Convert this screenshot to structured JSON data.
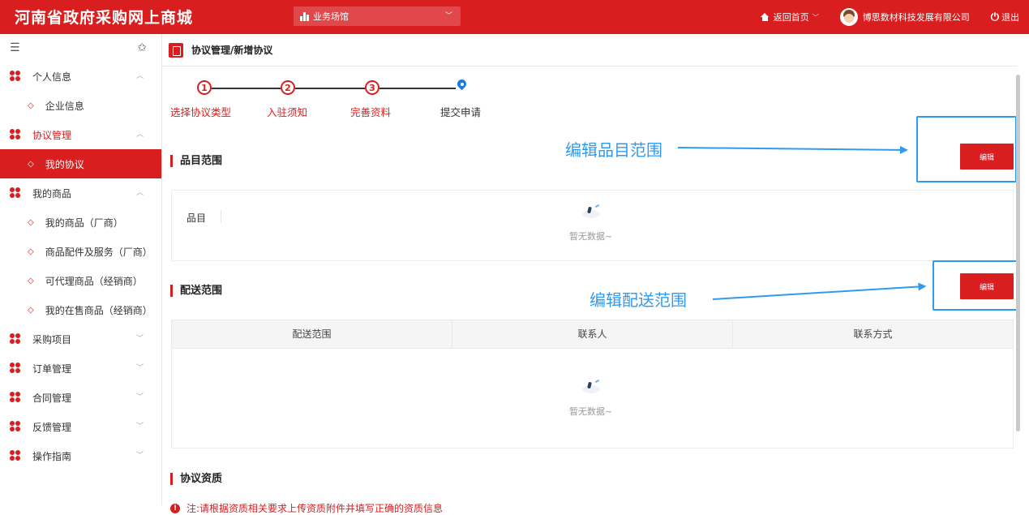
{
  "header": {
    "brand": "河南省政府采购网上商城",
    "venue_label": "业务场馆",
    "home_label": "返回首页",
    "company": "博思数材科技发展有限公司",
    "logout": "退出"
  },
  "sidebar": {
    "groups": [
      {
        "label": "个人信息",
        "arrow": "︿",
        "items": [
          {
            "label": "企业信息"
          }
        ]
      },
      {
        "label": "协议管理",
        "arrow": "︿",
        "items": [
          {
            "label": "我的协议"
          }
        ]
      },
      {
        "label": "我的商品",
        "arrow": "︿",
        "items": [
          {
            "label": "我的商品（厂商）"
          },
          {
            "label": "商品配件及服务（厂商）"
          },
          {
            "label": "可代理商品（经销商）"
          },
          {
            "label": "我的在售商品（经销商）"
          }
        ]
      },
      {
        "label": "采购项目",
        "arrow": "﹀"
      },
      {
        "label": "订单管理",
        "arrow": "﹀"
      },
      {
        "label": "合同管理",
        "arrow": "﹀"
      },
      {
        "label": "反馈管理",
        "arrow": "﹀"
      },
      {
        "label": "操作指南",
        "arrow": "﹀"
      }
    ]
  },
  "main": {
    "breadcrumb": "协议管理/新增协议",
    "steps": [
      {
        "num": "1",
        "label": "选择协议类型"
      },
      {
        "num": "2",
        "label": "入驻须知"
      },
      {
        "num": "3",
        "label": "完善资料"
      },
      {
        "num": "",
        "label": "提交申请"
      }
    ],
    "category_section": {
      "title": "品目范围",
      "edit_label": "编辑",
      "annotation": "编辑品目范围",
      "field_label": "品目",
      "empty_text": "暂无数据~"
    },
    "delivery_section": {
      "title": "配送范围",
      "edit_label": "编辑",
      "annotation": "编辑配送范围",
      "columns": [
        "配送范围",
        "联系人",
        "联系方式"
      ],
      "empty_text": "暂无数据~"
    },
    "qualification_section": {
      "title": "协议资质",
      "warning": "注:请根据资质相关要求上传资质附件并填写正确的资质信息"
    }
  }
}
